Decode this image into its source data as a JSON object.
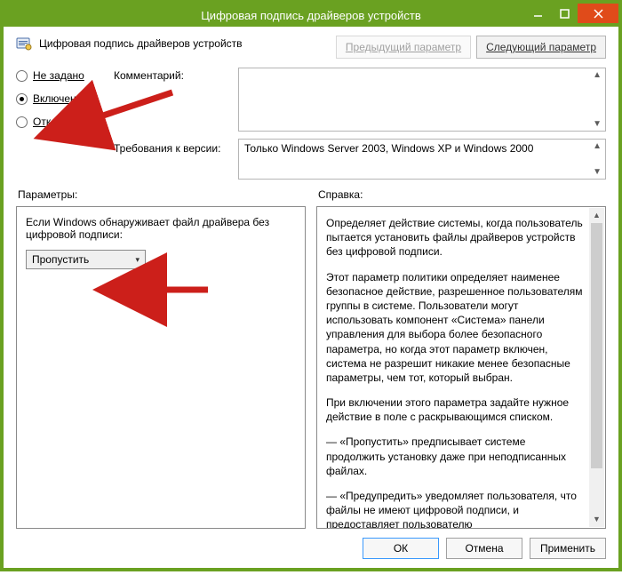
{
  "window": {
    "title": "Цифровая подпись драйверов устройств"
  },
  "header": {
    "policy_title": "Цифровая подпись драйверов устройств",
    "prev_btn": "Предыдущий параметр",
    "next_btn": "Следующий параметр"
  },
  "radios": {
    "not_configured": "Не задано",
    "enabled": "Включено",
    "disabled": "Отключено",
    "selected": "enabled"
  },
  "labels": {
    "comment": "Комментарий:",
    "requirements": "Требования к версии:",
    "options": "Параметры:",
    "help": "Справка:"
  },
  "requirements_text": "Только Windows Server 2003, Windows XP и Windows 2000",
  "options": {
    "prompt": "Если Windows обнаруживает файл драйвера без цифровой подписи:",
    "select_value": "Пропустить"
  },
  "help": {
    "p1": "Определяет действие системы, когда пользователь пытается установить файлы драйверов устройств без цифровой подписи.",
    "p2": "Этот параметр политики определяет наименее безопасное действие, разрешенное пользователям группы в системе. Пользователи могут использовать компонент «Система» панели управления для выбора более безопасного параметра, но когда этот параметр включен, система не разрешит никакие менее безопасные параметры, чем тот, который выбран.",
    "p3": "При включении этого параметра задайте нужное действие в поле с раскрывающимся списком.",
    "p4": "— «Пропустить» предписывает системе продолжить установку даже при неподписанных файлах.",
    "p5": "— «Предупредить» уведомляет пользователя, что файлы не имеют цифровой подписи, и предоставляет пользователю"
  },
  "footer": {
    "ok": "ОК",
    "cancel": "Отмена",
    "apply": "Применить"
  },
  "colors": {
    "accent": "#6aa121",
    "close": "#e04b1a",
    "arrow": "#cc1f1a"
  }
}
